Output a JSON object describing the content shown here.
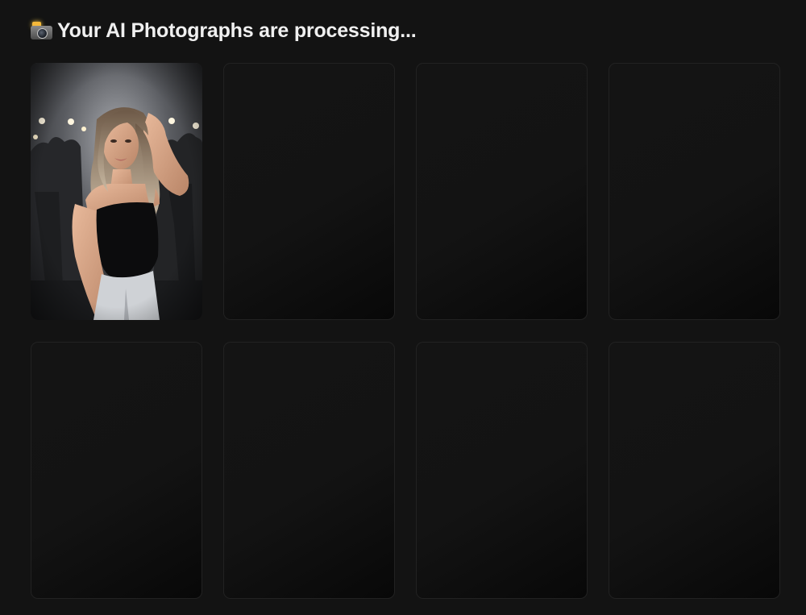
{
  "header": {
    "icon": "camera-with-flash-icon",
    "title": "Your AI Photographs are processing..."
  },
  "gallery": {
    "tiles": [
      {
        "state": "complete",
        "content": "photo"
      },
      {
        "state": "processing"
      },
      {
        "state": "processing"
      },
      {
        "state": "processing"
      },
      {
        "state": "processing"
      },
      {
        "state": "processing"
      },
      {
        "state": "processing"
      },
      {
        "state": "processing"
      }
    ]
  },
  "colors": {
    "background": "#131313",
    "tile_border": "#222222",
    "text": "#f0f0f0"
  }
}
